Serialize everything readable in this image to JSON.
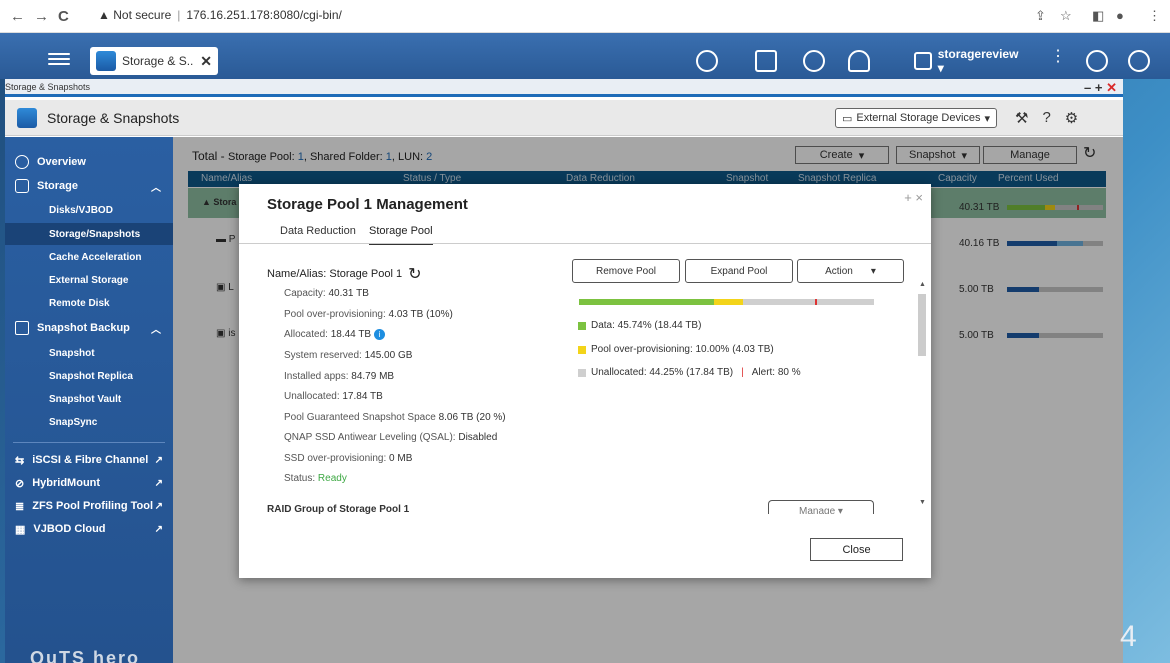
{
  "browser": {
    "back": "←",
    "forward": "→",
    "reload": "C",
    "security": "Not secure",
    "url": "176.16.251.178:8080/cgi-bin/"
  },
  "qts": {
    "app_tab_label": "Storage & S...",
    "user": "storagereview ▾"
  },
  "window": {
    "title": "Storage & Snapshots",
    "controls": "– + ×"
  },
  "app": {
    "title": "Storage & Snapshots",
    "external_button": "External Storage Devices"
  },
  "sidebar": {
    "overview": "Overview",
    "storage": "Storage",
    "storage_items": [
      "Disks/VJBOD",
      "Storage/Snapshots",
      "Cache Acceleration",
      "External Storage",
      "Remote Disk"
    ],
    "snapshot_backup": "Snapshot Backup",
    "snapshot_items": [
      "Snapshot",
      "Snapshot Replica",
      "Snapshot Vault",
      "SnapSync"
    ],
    "links": [
      "iSCSI & Fibre Channel",
      "HybridMount",
      "ZFS Pool Profiling Tool",
      "VJBOD Cloud"
    ]
  },
  "main": {
    "total_label": "Total - ",
    "total_pool_label": "Storage Pool: ",
    "total_pool_count": "1",
    "total_folder_label": ", Shared Folder: ",
    "total_folder_count": "1",
    "total_lun_label": ", LUN: ",
    "total_lun_count": "2",
    "create_label": "Create",
    "snapshot_label": "Snapshot",
    "manage_label": "Manage",
    "columns": [
      "Name/Alias",
      "Status / Type",
      "Data Reduction",
      "Snapshot",
      "Snapshot Replica",
      "Capacity",
      "Percent Used"
    ],
    "rows": [
      {
        "name": "Stora",
        "capacity": "40.31 TB"
      },
      {
        "name": "P",
        "capacity": "40.16 TB"
      },
      {
        "name": "L",
        "capacity": "5.00 TB"
      },
      {
        "name": "is",
        "capacity": "5.00 TB"
      }
    ]
  },
  "dialog": {
    "title": "Storage Pool 1 Management",
    "controls": "+ ×",
    "tabs": [
      "Data Reduction",
      "Storage Pool"
    ],
    "name_label": "Name/Alias: Storage Pool 1",
    "props": [
      {
        "k": "Capacity:",
        "v": "40.31 TB"
      },
      {
        "k": "Pool over-provisioning:",
        "v": "4.03 TB (10%)"
      },
      {
        "k": "Allocated:",
        "v": "18.44 TB"
      },
      {
        "k": "System reserved:",
        "v": "145.00 GB"
      },
      {
        "k": "Installed apps:",
        "v": "84.79 MB"
      },
      {
        "k": "Unallocated:",
        "v": "17.84 TB"
      },
      {
        "k": "Pool Guaranteed Snapshot Space",
        "v": "8.06 TB (20 %)"
      },
      {
        "k": "QNAP SSD Antiwear Leveling (QSAL):",
        "v": "Disabled"
      },
      {
        "k": "SSD over-provisioning:",
        "v": "0 MB"
      },
      {
        "k": "Status:",
        "v": "Ready"
      }
    ],
    "remove_pool": "Remove Pool",
    "expand_pool": "Expand Pool",
    "action": "Action",
    "usage": {
      "data_fraction": 0.4574,
      "overprov_fraction": 0.1,
      "alert_fraction": 0.8,
      "colors": {
        "data": "#7cc240",
        "overprov": "#f3d41a",
        "unallocated": "#cfcfcf",
        "alert": "#d33"
      }
    },
    "legend": {
      "data": "Data: 45.74% (18.44 TB)",
      "overprov": "Pool over-provisioning: 10.00% (4.03 TB)",
      "unallocated": "Unallocated: 44.25% (17.84 TB)",
      "alert": "Alert: 80 %"
    },
    "raid_title": "RAID Group of Storage Pool 1",
    "raid_manage": "Manage",
    "close": "Close"
  },
  "decor": {
    "logo": "QuTS hero",
    "corner": "4"
  }
}
